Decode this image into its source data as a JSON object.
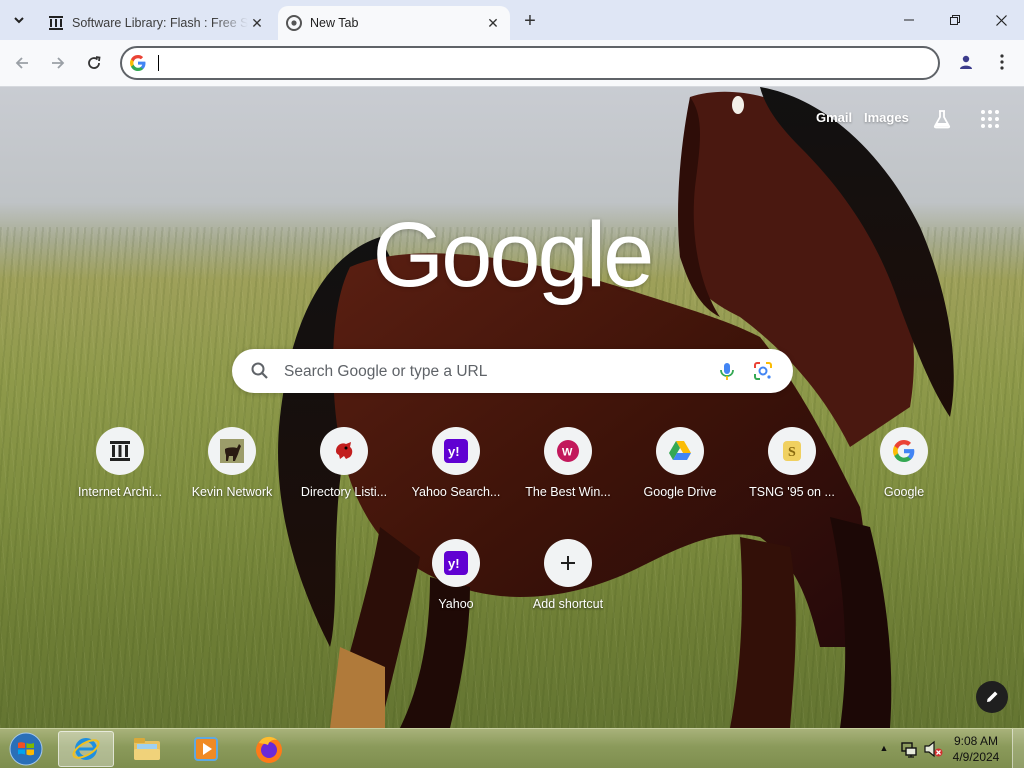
{
  "browser": {
    "tabs": [
      {
        "title": "Software Library: Flash : Free So",
        "favicon": "archive-icon",
        "active": false
      },
      {
        "title": "New Tab",
        "favicon": "chrome-icon",
        "active": true
      }
    ],
    "omnibox": {
      "value": "",
      "placeholder": ""
    }
  },
  "ntp": {
    "links": {
      "gmail": "Gmail",
      "images": "Images"
    },
    "logo": "Google",
    "search": {
      "placeholder": "Search Google or type a URL"
    },
    "shortcuts": [
      {
        "label": "Internet Archi...",
        "icon": "archive-icon"
      },
      {
        "label": "Kevin Network",
        "icon": "horse-thumbnail-icon"
      },
      {
        "label": "Directory Listi...",
        "icon": "red-dragon-icon"
      },
      {
        "label": "Yahoo Search...",
        "icon": "yahoo-icon"
      },
      {
        "label": "The Best Win...",
        "icon": "w-icon"
      },
      {
        "label": "Google Drive",
        "icon": "google-drive-icon"
      },
      {
        "label": "TSNG '95 on ...",
        "icon": "tsng-icon"
      },
      {
        "label": "Google",
        "icon": "google-g-icon"
      },
      {
        "label": "Yahoo",
        "icon": "yahoo-icon"
      },
      {
        "label": "Add shortcut",
        "icon": "plus-icon"
      }
    ]
  },
  "taskbar": {
    "clock": {
      "time": "9:08 AM",
      "date": "4/9/2024"
    }
  },
  "colors": {
    "yahoo": "#6001d2",
    "w_badge": "#c2185b",
    "tsng": "#f0d060"
  }
}
